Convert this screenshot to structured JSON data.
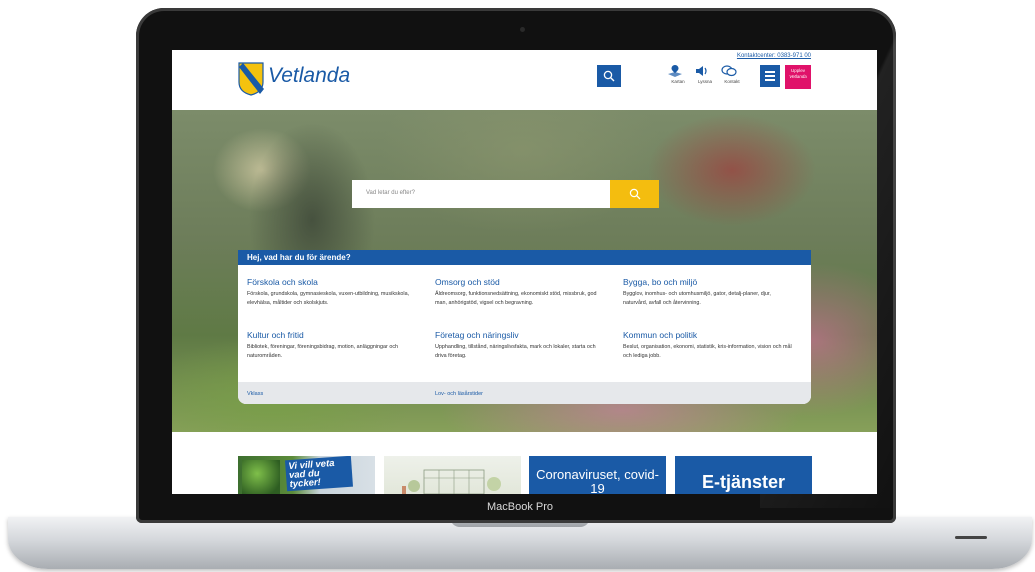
{
  "device": {
    "label": "MacBook Pro"
  },
  "header": {
    "contact": "Kontaktcenter: 0383-971 00",
    "logo_text": "Vetlanda",
    "icons": [
      {
        "label": "Kartan",
        "icon": "map-icon"
      },
      {
        "label": "Lyssna",
        "icon": "speaker-icon"
      },
      {
        "label": "Kontakt",
        "icon": "chat-icon"
      }
    ],
    "upplev": [
      "Upplev",
      "Vetlanda"
    ]
  },
  "hero": {
    "search_placeholder": "Vad letar du efter?"
  },
  "panel": {
    "title": "Hej, vad har du för ärende?",
    "categories": [
      {
        "title": "Förskola och skola",
        "desc": "Förskola, grundskola, gymnasieskola, vuxen-utbildning, musikskola, elevhälsa, måltider och skolskjuts."
      },
      {
        "title": "Omsorg och stöd",
        "desc": "Äldreomsorg, funktionsnedsättning, ekonomiskt stöd, missbruk, god man, anhörigstöd, vigsel och begravning."
      },
      {
        "title": "Bygga, bo och miljö",
        "desc": "Bygglov, inomhus- och utomhusmiljö, gator, detalj-planer, djur, naturvård, avfall och återvinning."
      },
      {
        "title": "Kultur och fritid",
        "desc": "Bibliotek, föreningar, föreningsbidrag, motion, anläggningar och naturområden."
      },
      {
        "title": "Företag och näringsliv",
        "desc": "Upphandling, tillstånd, näringslivsfakta, mark och lokaler, starta och driva företag."
      },
      {
        "title": "Kommun och politik",
        "desc": "Beslut, organisation, ekonomi, statistik, kris-information, vision och mål och lediga jobb."
      }
    ],
    "footer_links": [
      "Vklass",
      "Lov- och läsårstider"
    ]
  },
  "cards": {
    "card1_text": "Vi vill veta vad du tycker!",
    "card3_title": "Coronaviruset, covid-19",
    "card4_title": "E-tjänster"
  },
  "colors": {
    "brand_blue": "#1a5aa6",
    "search_yellow": "#f4bd0f",
    "upplev_pink": "#e0126a"
  }
}
